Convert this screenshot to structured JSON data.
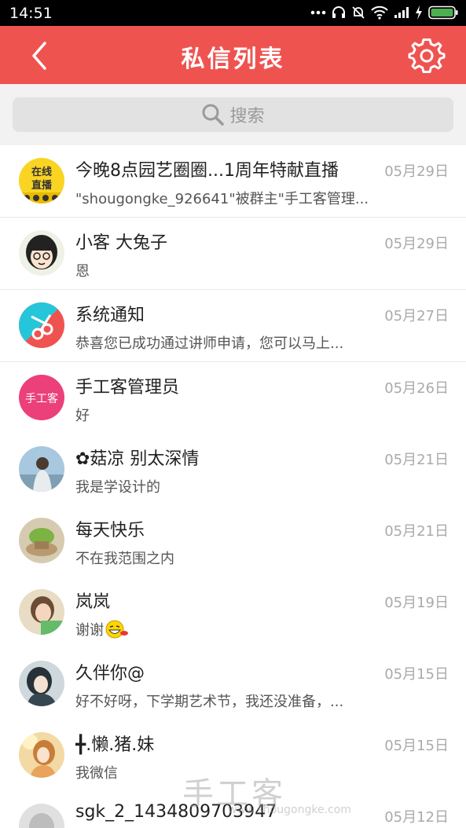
{
  "status_bar": {
    "time": "14:51",
    "icons": [
      "more-dots-icon",
      "headphones-icon",
      "mute-bell-icon",
      "wifi-icon",
      "signal-icon",
      "charging-icon",
      "battery-icon"
    ],
    "battery_color": "#4caf50"
  },
  "header": {
    "title": "私信列表",
    "background": "#ef5350",
    "back_icon": "chevron-left-icon",
    "settings_icon": "gear-icon"
  },
  "search": {
    "placeholder": "搜索",
    "icon": "search-icon"
  },
  "messages": [
    {
      "name": "今晚8点园艺圈圈...1周年特献直播",
      "preview": "\"shougongke_926641\"被群主\"手工客管理...",
      "date": "05月29日",
      "avatar_text": "在线直播"
    },
    {
      "name": "小客 大兔子",
      "preview": "恩",
      "date": "05月29日"
    },
    {
      "name": "系统通知",
      "preview": "恭喜您已成功通过讲师申请，您可以马上...",
      "date": "05月27日"
    },
    {
      "name": "手工客管理员",
      "preview": "好",
      "date": "05月26日",
      "avatar_text": "手工客"
    },
    {
      "name": "✿菇凉  别太深情",
      "preview": "我是学设计的",
      "date": "05月21日"
    },
    {
      "name": "每天快乐",
      "preview": "不在我范围之内",
      "date": "05月21日"
    },
    {
      "name": "岚岚",
      "preview": "谢谢",
      "date": "05月19日"
    },
    {
      "name": "久伴你@",
      "preview": "好不好呀，下学期艺术节，我还没准备，...",
      "date": "05月15日"
    },
    {
      "name": "╋.懒.猪.妹",
      "preview": "我微信",
      "date": "05月15日"
    },
    {
      "name": "sgk_2_1434809703947",
      "preview": "",
      "date": "05月12日"
    }
  ],
  "watermark": {
    "text": "手工客",
    "sub": "www.shougongke.com"
  }
}
